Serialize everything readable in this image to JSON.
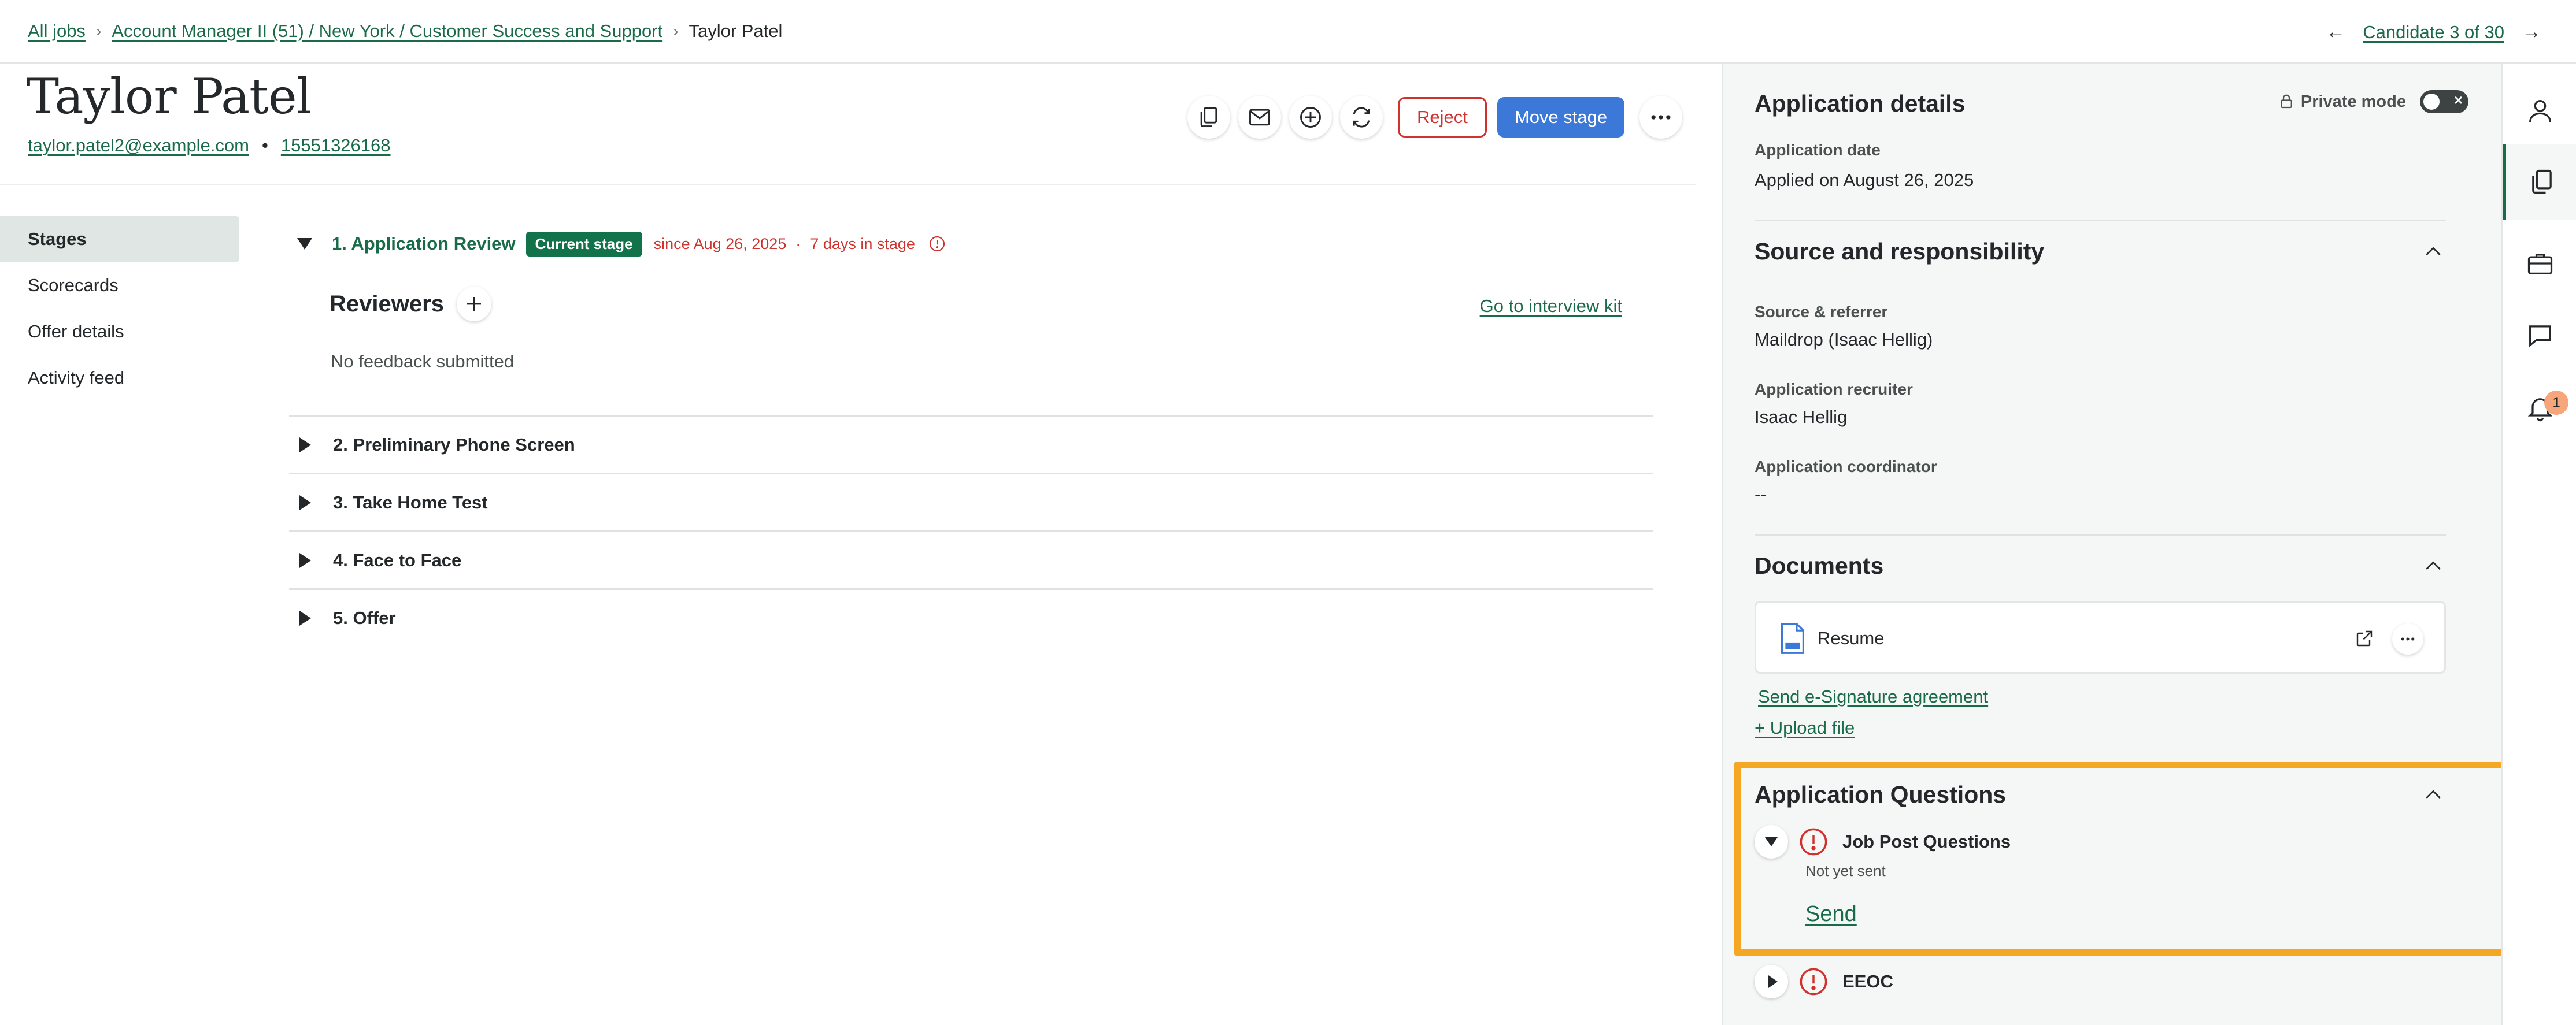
{
  "breadcrumb": {
    "all_jobs": "All jobs",
    "job": "Account Manager II (51) / New York / Customer Success and Support",
    "current": "Taylor Patel"
  },
  "pager": {
    "label": "Candidate 3 of 30"
  },
  "candidate": {
    "name": "Taylor Patel",
    "email": "taylor.patel2@example.com",
    "separator": "•",
    "phone": "15551326168"
  },
  "actions": {
    "reject_label": "Reject",
    "move_stage_label": "Move stage",
    "icons": [
      "copy-icon",
      "mail-icon",
      "add-circle-icon",
      "refresh-icon",
      "more-icon"
    ]
  },
  "leftnav": {
    "items": [
      {
        "label": "Stages",
        "active": true
      },
      {
        "label": "Scorecards",
        "active": false
      },
      {
        "label": "Offer details",
        "active": false
      },
      {
        "label": "Activity feed",
        "active": false
      }
    ]
  },
  "stages": {
    "active": {
      "title": "1. Application Review",
      "badge": "Current stage",
      "since": "since Aug 26, 2025",
      "sep": "·",
      "days": "7 days in stage"
    },
    "reviewers": {
      "title": "Reviewers",
      "interview_kit": "Go to interview kit",
      "no_feedback": "No feedback submitted"
    },
    "collapsed": [
      {
        "label": "2. Preliminary Phone Screen"
      },
      {
        "label": "3. Take Home Test"
      },
      {
        "label": "4. Face to Face"
      },
      {
        "label": "5. Offer"
      }
    ]
  },
  "details": {
    "title": "Application details",
    "private_mode": "Private mode",
    "private_mode_on": false,
    "application_date_label": "Application date",
    "application_date_value": "Applied on August 26, 2025"
  },
  "source": {
    "title": "Source and responsibility",
    "fields": [
      {
        "label": "Source & referrer",
        "value": "Maildrop (Isaac Hellig)"
      },
      {
        "label": "Application recruiter",
        "value": "Isaac Hellig"
      },
      {
        "label": "Application coordinator",
        "value": "--"
      }
    ]
  },
  "documents": {
    "title": "Documents",
    "file": "Resume",
    "send_esign": "Send e-Signature agreement",
    "upload": "+ Upload file"
  },
  "questions": {
    "title": "Application Questions",
    "items": [
      {
        "title": "Job Post Questions",
        "status": "Not yet sent",
        "action": "Send",
        "expanded": true
      },
      {
        "title": "EEOC",
        "expanded": false
      }
    ]
  },
  "rail": {
    "notification_count": "1",
    "icons": [
      "person-icon",
      "documents-icon",
      "briefcase-icon",
      "chat-icon",
      "bell-icon"
    ]
  },
  "colors": {
    "link_green": "#1a6b4a",
    "badge_green": "#127249",
    "reject_red": "#d0322d",
    "primary_blue": "#3c78d8",
    "highlight_orange": "#f5a623"
  }
}
